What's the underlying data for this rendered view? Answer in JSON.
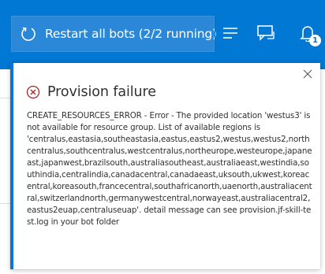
{
  "toolbar": {
    "restart_label": "Restart all bots (2/2 running)",
    "restart_icon": "restart-icon",
    "menu_icon": "list-menu-icon",
    "chat_icon": "chat-icon",
    "notification_icon": "notification-bell-icon",
    "notification_count": "1"
  },
  "notification": {
    "status_icon": "error-circle-icon",
    "title": "Provision failure",
    "message": "CREATE_RESOURCES_ERROR - Error - The provided location 'westus3' is not available for resource group. List of available regions is\n'centralus,eastasia,southeastasia,eastus,eastus2,westus,westus2,northcentralus,southcentralus,westcentralus,northeurope,westeurope,japaneast,japanwest,brazilsouth,australiasoutheast,australiaeast,westindia,southindia,centralindia,canadacentral,canadaeast,uksouth,ukwest,koreacentral,koreasouth,francecentral,southafricanorth,uaenorth,australiacentral,switzerlandnorth,germanywestcentral,norwayeast,australiacentral2,eastus2euap,centraluseuap'. detail message can see provision.jf-skill-test.log in your bot folder",
    "close_icon": "close-icon"
  },
  "colors": {
    "header_bg": "#0078d4",
    "button_bg": "#2b88d8",
    "accent": "#0078d4",
    "error": "#a4262c",
    "text": "#323130"
  }
}
